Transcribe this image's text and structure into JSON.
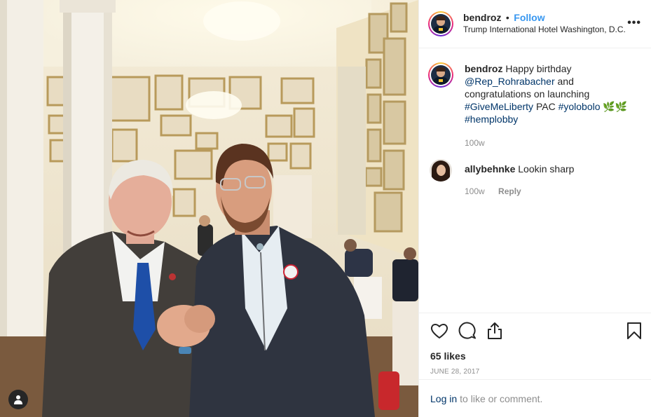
{
  "post": {
    "author": "bendroz",
    "dot": "•",
    "follow_label": "Follow",
    "location": "Trump International Hotel Washington, D.C.",
    "more_icon": "more-horizontal-icon",
    "more_label": "•••"
  },
  "caption": {
    "author": "bendroz",
    "text_1": "Happy birthday",
    "mention": "@Rep_Rohrabacher",
    "text_2": "and congratulations on launching",
    "hashtag_1": "#GiveMeLiberty",
    "text_3": "PAC",
    "hashtag_2": "#yolobolo",
    "emoji": "🌿🌿",
    "hashtag_3": "#hemplobby",
    "time": "100w"
  },
  "comments": [
    {
      "author": "allybehnke",
      "text": "Lookin sharp",
      "time": "100w",
      "reply_label": "Reply"
    }
  ],
  "actions": {
    "like_icon": "heart-icon",
    "comment_icon": "comment-icon",
    "share_icon": "share-icon",
    "save_icon": "bookmark-icon",
    "likes": "65 likes",
    "date": "JUNE 28, 2017"
  },
  "login": {
    "link": "Log in",
    "rest": "to like or comment."
  },
  "photo": {
    "user_tag_icon": "person-icon"
  },
  "colors": {
    "link": "#003569",
    "follow": "#3897f0",
    "muted": "#8e8e8e",
    "text": "#262626"
  }
}
